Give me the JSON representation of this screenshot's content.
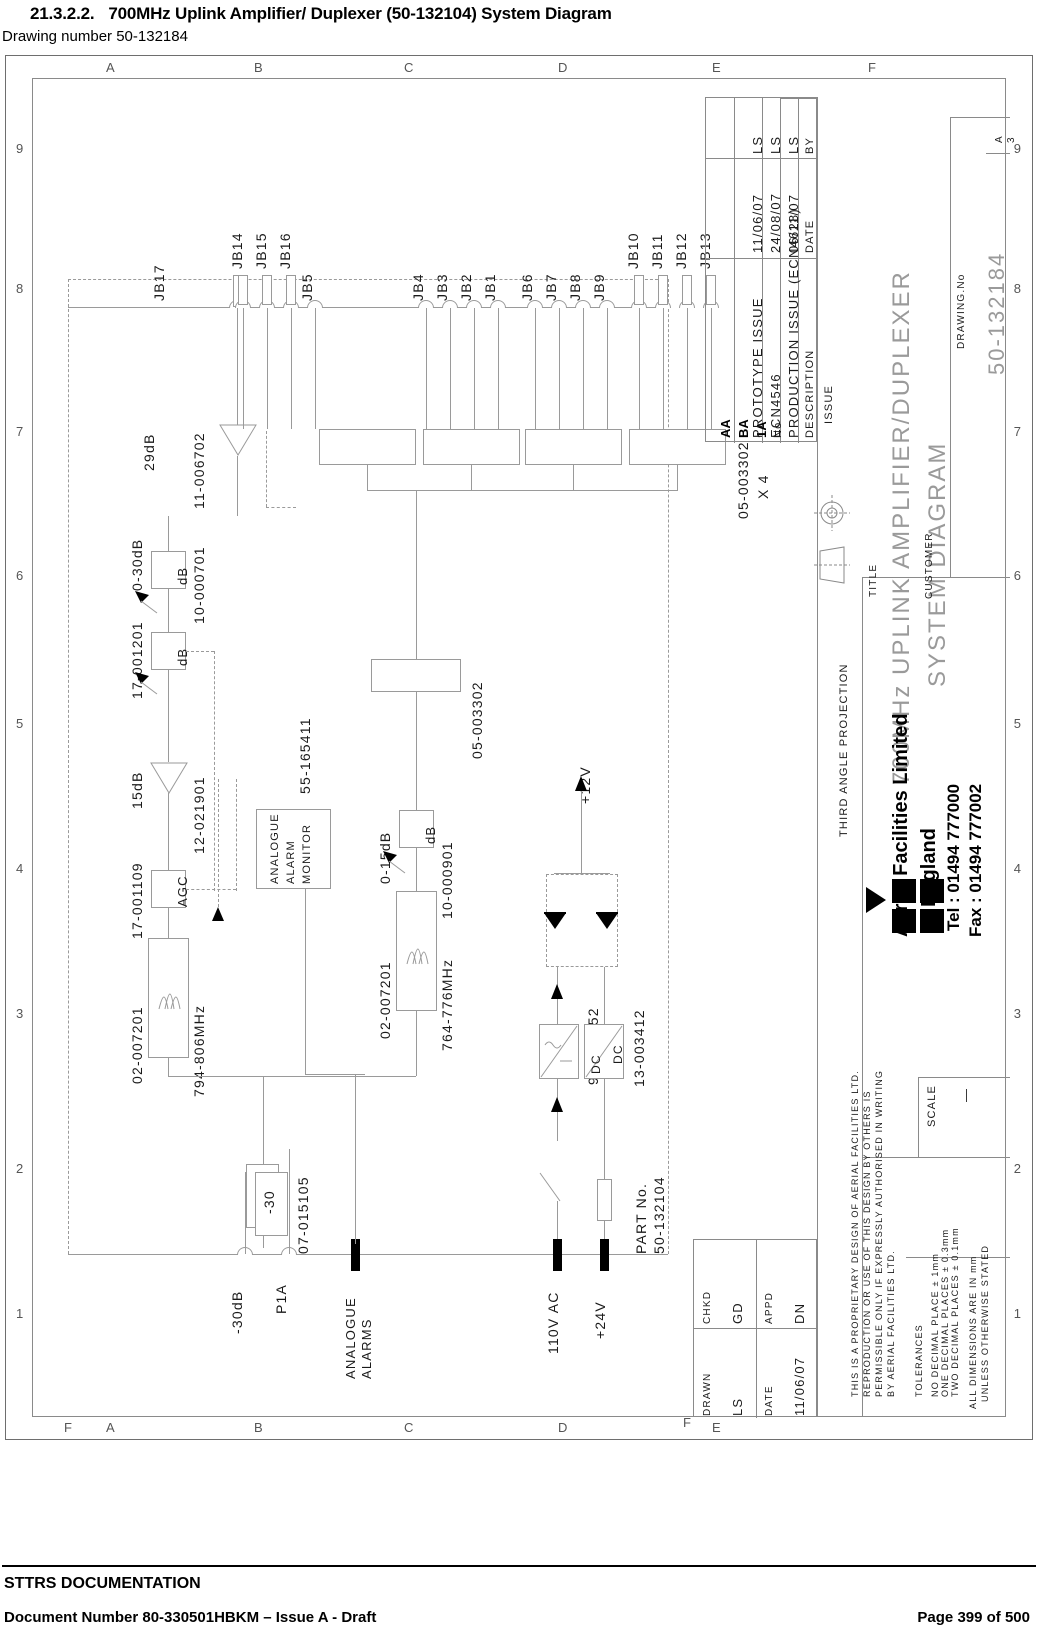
{
  "header": {
    "section_number": "21.3.2.2.",
    "title": "700MHz Uplink Amplifier/ Duplexer (50-132104) System Diagram",
    "subtitle": "Drawing number 50-132184"
  },
  "footer": {
    "doc_set": "STTRS DOCUMENTATION",
    "doc_number": "Document Number 80-330501HBKM – Issue A - Draft",
    "page": "Page 399 of 500"
  },
  "drawing": {
    "zone_letters_top": [
      "A",
      "B",
      "C",
      "D",
      "E",
      "F"
    ],
    "zone_letters_bottom": [
      "A",
      "B",
      "C",
      "D",
      "E",
      "F"
    ],
    "zone_numbers_left": [
      "9",
      "8",
      "7",
      "6",
      "5",
      "4",
      "3",
      "2",
      "1"
    ],
    "zone_numbers_right": [
      "9",
      "8",
      "7",
      "6",
      "5",
      "4",
      "3",
      "2",
      "1"
    ],
    "sheet_size": "A",
    "sheet_scale_num": "3",
    "connectors": [
      "JB17",
      "JB14",
      "JB15",
      "JB16",
      "JB5",
      "JB4",
      "JB3",
      "JB2",
      "JB1",
      "JB6",
      "JB7",
      "JB8",
      "JB9",
      "JB10",
      "JB11",
      "JB12",
      "JB13"
    ],
    "rf_chain": {
      "amp_gain_top": "29dB",
      "amp_top_part": "11-006702",
      "atten_1_range": "0-30dB",
      "atten_1_part": "10-000701",
      "atten_1_label": "dB",
      "atten_2_part": "17-001201",
      "atten_2_label": "dB",
      "amp_gain_mid": "15dB",
      "amp_mid_part": "12-021901",
      "agc_label": "AGC",
      "agc_part": "17-001109",
      "filter_1_part": "02-007201",
      "filter_1_band": "794-806MHz",
      "filter_2_part": "02-007201",
      "filter_2_band": "764-776MHz",
      "atten_3_range": "0-15dB",
      "atten_3_part": "10-000901",
      "atten_3_label": "dB",
      "splitter_part": "05-003302",
      "splitter_group_part": "05-003302",
      "splitter_group_qty": "X 4",
      "alarm_monitor_part": "55-165411",
      "alarm_monitor_label_1": "ANALOGUE",
      "alarm_monitor_label_2": "ALARM",
      "alarm_monitor_label_3": "MONITOR",
      "coupler_part": "07-015105",
      "coupler_value": "-30",
      "port_minus30db": "-30dB",
      "port_p1a": "P1A",
      "port_analogue_alarms_1": "ANALOGUE",
      "port_analogue_alarms_2": "ALARMS"
    },
    "power": {
      "output_12v": "+12V",
      "psu_part": "96-300052",
      "dcdc_part": "13-003412",
      "dcdc_label_in": "DC",
      "dcdc_label_out": "DC",
      "input_ac": "110V AC",
      "input_24v": "+24V",
      "part_no_label": "PART No.",
      "part_no_value": "50-132104"
    },
    "title_block": {
      "title_label": "TITLE",
      "title_line_1": "700MHz UPLINK AMPLIFIER/DUPLEXER",
      "title_line_2": "SYSTEM DIAGRAM",
      "drawing_no_label": "DRAWING.No",
      "drawing_no_value": "50-132184",
      "customer_label": "CUSTOMER",
      "customer_value": "",
      "scale_label": "SCALE",
      "scale_value": "—",
      "projection_label": "THIRD ANGLE PROJECTION",
      "company_name": "Aerial Facilities Limited",
      "company_country": "England",
      "company_tel": "Tel : 01494 777000",
      "company_fax": "Fax : 01494 777002",
      "proprietary_notice": [
        "THIS IS A PROPRIETARY DESIGN OF AERIAL FACILITIES LTD.",
        "REPRODUCTION OR USE OF THIS DESIGN BY OTHERS IS",
        "PERMISSIBLE ONLY IF EXPRESSLY AUTHORISED IN WRITING",
        "BY AERIAL FACILITIES LTD."
      ],
      "tolerances_label": "TOLERANCES",
      "tolerances": [
        "NO DECIMAL PLACE ± 1mm",
        "ONE DECIMAL PLACES ± 0.3mm",
        "TWO DECIMAL PLACES ± 0.1mm"
      ],
      "dimension_note": [
        "ALL DIMENSIONS ARE IN mm",
        "UNLESS OTHERWISE STATED"
      ],
      "drawn_label": "DRAWN",
      "drawn_value": "LS",
      "chkd_label": "CHKD",
      "chkd_value": "GD",
      "date_label": "DATE",
      "date_value": "11/06/07",
      "appd_label": "APPD",
      "appd_value": "DN",
      "frame_letter_left": "F",
      "issue_word": "ISSUE"
    },
    "revision_table": {
      "headers": {
        "no": "No",
        "description": "DESCRIPTION",
        "date": "DATE",
        "by": "BY"
      },
      "rows": [
        {
          "no": "1A",
          "description": "PRODUCTION ISSUE (ECN4628)",
          "date": "06/11/07",
          "by": "LS"
        },
        {
          "no": "BA",
          "description": "ECN4546",
          "date": "24/08/07",
          "by": "LS"
        },
        {
          "no": "AA",
          "description": "PROTOTYPE ISSUE",
          "date": "11/06/07",
          "by": "LS"
        }
      ]
    }
  }
}
